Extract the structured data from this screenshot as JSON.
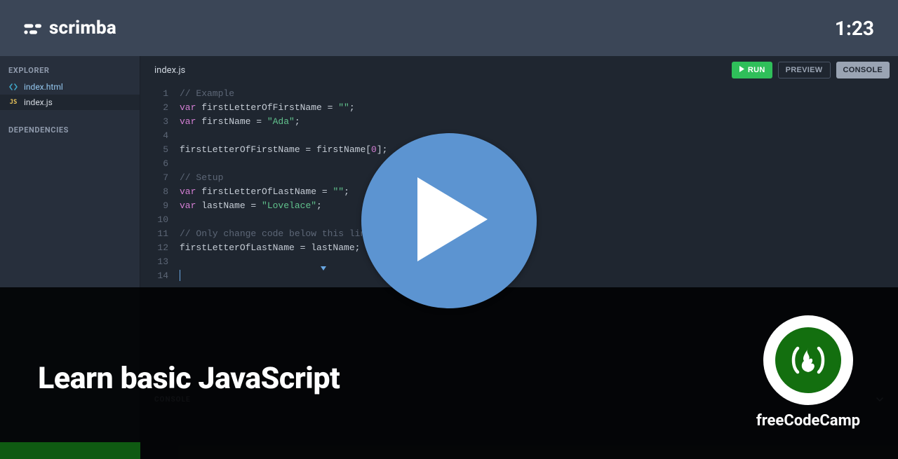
{
  "header": {
    "brand": "scrimba",
    "timer": "1:23"
  },
  "sidebar": {
    "explorer_label": "EXPLORER",
    "dependencies_label": "DEPENDENCIES",
    "files": [
      {
        "name": "index.html",
        "icon": "html"
      },
      {
        "name": "index.js",
        "icon": "js"
      }
    ]
  },
  "editor": {
    "tab": "index.js",
    "buttons": {
      "run": "RUN",
      "preview": "PREVIEW",
      "console": "CONSOLE"
    },
    "code": [
      {
        "t": "comment",
        "text": "// Example"
      },
      {
        "t": "var-assign",
        "keyword": "var",
        "name": "firstLetterOfFirstName",
        "op": " = ",
        "value": "\"\"",
        "tail": ";"
      },
      {
        "t": "var-assign",
        "keyword": "var",
        "name": "firstName",
        "op": " = ",
        "value": "\"Ada\"",
        "tail": ";"
      },
      {
        "t": "blank"
      },
      {
        "t": "index-assign",
        "lhs": "firstLetterOfFirstName",
        "op": " = ",
        "rhs": "firstName[",
        "idx": "0",
        "tail": "];"
      },
      {
        "t": "blank"
      },
      {
        "t": "comment",
        "text": "// Setup"
      },
      {
        "t": "var-assign",
        "keyword": "var",
        "name": "firstLetterOfLastName",
        "op": " = ",
        "value": "\"\"",
        "tail": ";"
      },
      {
        "t": "var-assign",
        "keyword": "var",
        "name": "lastName",
        "op": " = ",
        "value": "\"Lovelace\"",
        "tail": ";"
      },
      {
        "t": "blank"
      },
      {
        "t": "comment",
        "text": "// Only change code below this line"
      },
      {
        "t": "plain",
        "text": "firstLetterOfLastName = lastName;"
      },
      {
        "t": "blank"
      },
      {
        "t": "caret"
      }
    ]
  },
  "console": {
    "label": "CONSOLE"
  },
  "overlay": {
    "title": "Learn basic JavaScript",
    "org": "freeCodeCamp"
  }
}
